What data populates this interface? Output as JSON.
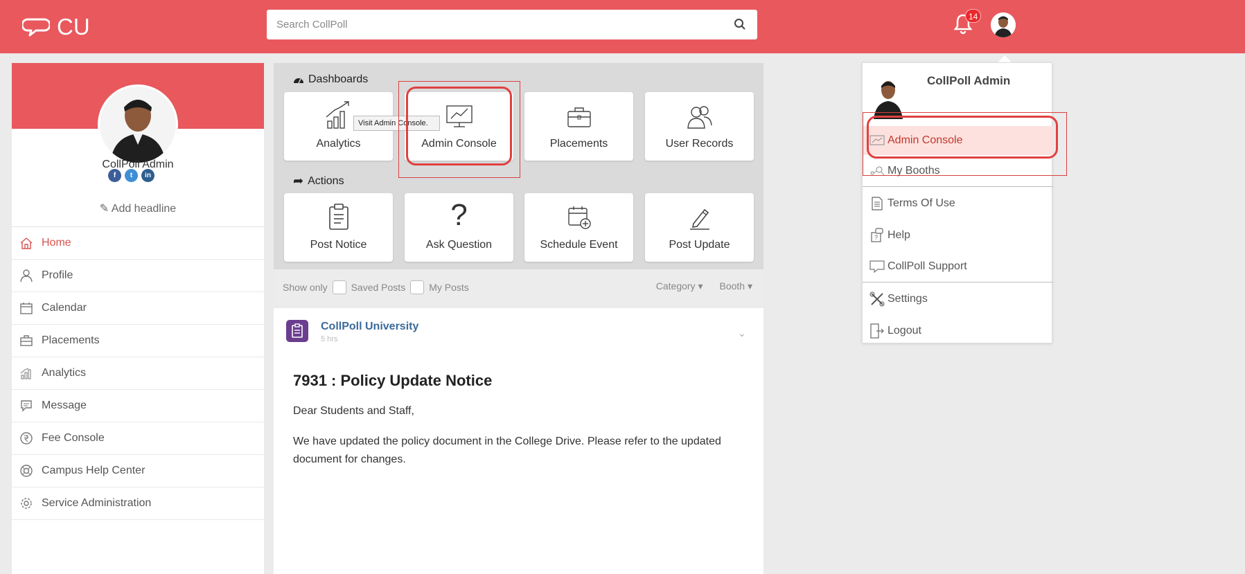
{
  "app": {
    "logo_text": "CU"
  },
  "search": {
    "placeholder": "Search CollPoll"
  },
  "notifications": {
    "count": "14"
  },
  "profile": {
    "name": "CollPoll Admin",
    "headline_link": "Add headline",
    "social": [
      "f",
      "t",
      "in"
    ]
  },
  "sidebar": {
    "items": [
      {
        "label": "Home",
        "icon": "home-icon"
      },
      {
        "label": "Profile",
        "icon": "person-icon"
      },
      {
        "label": "Calendar",
        "icon": "calendar-icon"
      },
      {
        "label": "Placements",
        "icon": "briefcase-icon"
      },
      {
        "label": "Analytics",
        "icon": "analytics-icon"
      },
      {
        "label": "Message",
        "icon": "message-icon"
      },
      {
        "label": "Fee Console",
        "icon": "rupee-icon"
      },
      {
        "label": "Campus Help Center",
        "icon": "lifebuoy-icon"
      },
      {
        "label": "Service Administration",
        "icon": "gear-icon"
      }
    ]
  },
  "dashboards": {
    "title": "Dashboards",
    "tiles": [
      {
        "label": "Analytics",
        "icon": "analytics-icon"
      },
      {
        "label": "Admin Console",
        "icon": "admin-console-icon"
      },
      {
        "label": "Placements",
        "icon": "briefcase-icon"
      },
      {
        "label": "User Records",
        "icon": "users-icon"
      }
    ],
    "tooltip": "Visit Admin Console."
  },
  "actions": {
    "title": "Actions",
    "tiles": [
      {
        "label": "Post Notice",
        "icon": "clipboard-icon"
      },
      {
        "label": "Ask Question",
        "icon": "question-icon"
      },
      {
        "label": "Schedule Event",
        "icon": "calendar-add-icon"
      },
      {
        "label": "Post Update",
        "icon": "pencil-icon"
      }
    ]
  },
  "filters": {
    "show_only": "Show only",
    "saved_posts": "Saved Posts",
    "my_posts": "My Posts",
    "category": "Category ▾",
    "booth": "Booth ▾"
  },
  "post": {
    "author": "CollPoll University",
    "time": "5 hrs",
    "title": "7931 : Policy Update Notice",
    "greeting": "Dear Students and Staff,",
    "body": "We have updated the policy document in the College Drive. Please refer to the updated document for changes."
  },
  "user_menu": {
    "name": "CollPoll Admin",
    "items": [
      {
        "label": "Admin Console",
        "icon": "admin-console-icon"
      },
      {
        "label": "My Booths",
        "icon": "booths-icon"
      },
      {
        "label": "Terms Of Use",
        "icon": "document-icon"
      },
      {
        "label": "Help",
        "icon": "help-icon"
      },
      {
        "label": "CollPoll Support",
        "icon": "support-icon"
      },
      {
        "label": "Settings",
        "icon": "settings-icon"
      },
      {
        "label": "Logout",
        "icon": "logout-icon"
      }
    ]
  },
  "colors": {
    "brand": "#e8585d",
    "highlight": "#e04040"
  }
}
